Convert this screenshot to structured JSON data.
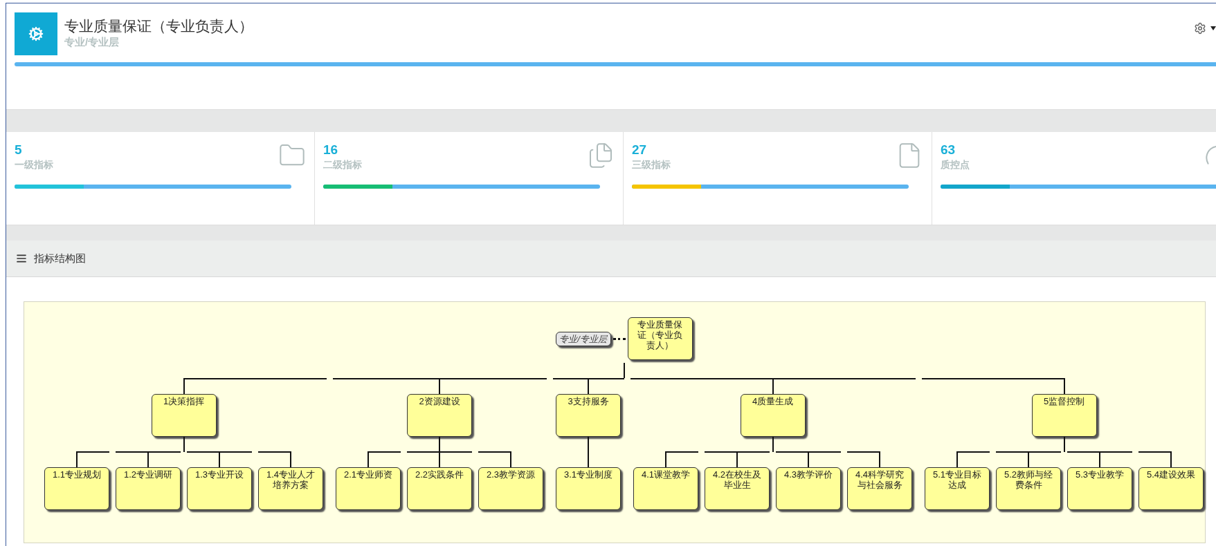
{
  "header": {
    "title": "专业质量保证（专业负责人）",
    "subtitle": "专业/专业层"
  },
  "stats": [
    {
      "value": "5",
      "label": "一级指标",
      "color": "#22c3da",
      "level": 0.25
    },
    {
      "value": "16",
      "label": "二级指标",
      "color": "#17bd74",
      "level": 0.25
    },
    {
      "value": "27",
      "label": "三级指标",
      "color": "#f5c400",
      "level": 0.25
    },
    {
      "value": "63",
      "label": "质控点",
      "color": "#13a6cb",
      "level": 0.25
    }
  ],
  "section": {
    "title": "指标结构图"
  },
  "tree": {
    "scope": "专业/专业层",
    "root": "专业质量保证（专业负责人）",
    "children": [
      {
        "label": "1决策指挥",
        "children": [
          {
            "label": "1.1专业规划"
          },
          {
            "label": "1.2专业调研"
          },
          {
            "label": "1.3专业开设"
          },
          {
            "label": "1.4专业人才培养方案"
          }
        ]
      },
      {
        "label": "2资源建设",
        "children": [
          {
            "label": "2.1专业师资"
          },
          {
            "label": "2.2实践条件"
          },
          {
            "label": "2.3教学资源"
          }
        ]
      },
      {
        "label": "3支持服务",
        "children": [
          {
            "label": "3.1专业制度"
          }
        ]
      },
      {
        "label": "4质量生成",
        "children": [
          {
            "label": "4.1课堂教学"
          },
          {
            "label": "4.2在校生及毕业生"
          },
          {
            "label": "4.3教学评价"
          },
          {
            "label": "4.4科学研究与社会服务"
          }
        ]
      },
      {
        "label": "5监督控制",
        "children": [
          {
            "label": "5.1专业目标达成"
          },
          {
            "label": "5.2教师与经费条件"
          },
          {
            "label": "5.3专业教学"
          },
          {
            "label": "5.4建设效果"
          }
        ]
      }
    ]
  }
}
